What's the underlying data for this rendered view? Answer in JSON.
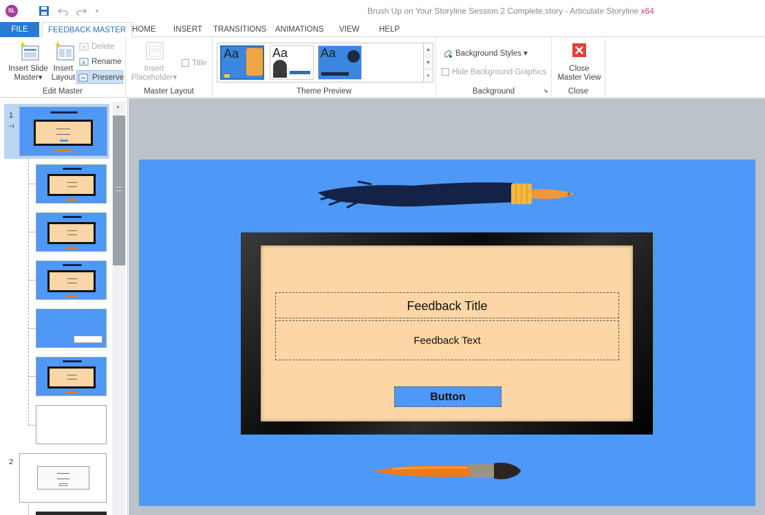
{
  "app": {
    "logo_text": "SL",
    "window_title": "Brush Up on Your Storyline Session 2 Complete.story - Articulate Storyline",
    "arch": "x64"
  },
  "quick_access": {
    "icons": [
      "save-icon",
      "undo-icon",
      "redo-icon",
      "customize-icon"
    ]
  },
  "tabs": [
    {
      "label": "FILE"
    },
    {
      "label": "FEEDBACK MASTER"
    },
    {
      "label": "HOME"
    },
    {
      "label": "INSERT"
    },
    {
      "label": "TRANSITIONS"
    },
    {
      "label": "ANIMATIONS"
    },
    {
      "label": "VIEW"
    },
    {
      "label": "HELP"
    }
  ],
  "ribbon": {
    "edit_master": {
      "label": "Edit Master",
      "insert_slide_master": "Insert Slide Master",
      "insert_slide_master_l1": "Insert Slide",
      "insert_slide_master_l2": "Master",
      "insert_layout_l1": "Insert",
      "insert_layout_l2": "Layout",
      "delete": "Delete",
      "rename": "Rename",
      "preserve": "Preserve"
    },
    "master_layout": {
      "label": "Master Layout",
      "insert_placeholder_l1": "Insert",
      "insert_placeholder_l2": "Placeholder",
      "title": "Title"
    },
    "theme_preview": {
      "label": "Theme Preview",
      "themes": [
        {
          "glyph": "Aa"
        },
        {
          "glyph": "Aa"
        },
        {
          "glyph": "Aa"
        }
      ]
    },
    "background": {
      "label": "Background",
      "background_styles": "Background Styles",
      "hide_background_graphics": "Hide Background Graphics"
    },
    "close": {
      "label": "Close",
      "close_master_view_l1": "Close",
      "close_master_view_l2": "Master View"
    }
  },
  "slide_panel": {
    "masters": [
      {
        "number": "1"
      },
      {
        "number": "2"
      }
    ]
  },
  "slide": {
    "feedback_title": "Feedback Title",
    "feedback_text": "Feedback Text",
    "button_label": "Button"
  },
  "colors": {
    "accent": "#2a7ad0",
    "slide_background": "#4e99f7",
    "frame_fill": "#fcd7a5",
    "brush_dark": "#142248",
    "brush_orange": "#e87914",
    "close_red": "#e2423a"
  }
}
